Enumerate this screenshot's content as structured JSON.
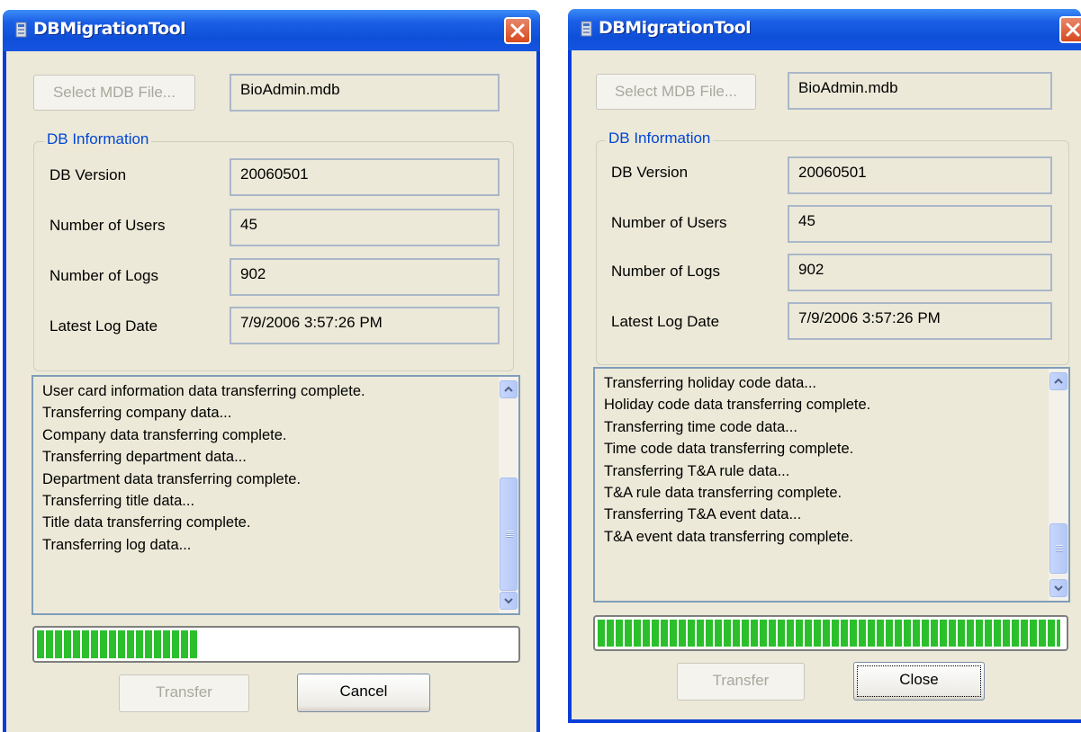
{
  "windows": [
    {
      "id": "left",
      "title": "DBMigrationTool",
      "select_button": "Select MDB File...",
      "file_name": "BioAdmin.mdb",
      "group_title": "DB Information",
      "fields": [
        {
          "label": "DB Version",
          "value": "20060501"
        },
        {
          "label": "Number of Users",
          "value": "45"
        },
        {
          "label": "Number of Logs",
          "value": "902"
        },
        {
          "label": "Latest Log Date",
          "value": "7/9/2006 3:57:26 PM"
        }
      ],
      "log_lines": [
        "User card information data transferring complete.",
        "Transferring company data...",
        "Company data transferring complete.",
        "Transferring department data...",
        "Department data transferring complete.",
        "Transferring title data...",
        "Title data transferring complete.",
        "Transferring log data..."
      ],
      "progress_fraction": 0.34,
      "transfer_button": "Transfer",
      "second_button": "Cancel"
    },
    {
      "id": "right",
      "title": "DBMigrationTool",
      "select_button": "Select MDB File...",
      "file_name": "BioAdmin.mdb",
      "group_title": "DB Information",
      "fields": [
        {
          "label": "DB Version",
          "value": "20060501"
        },
        {
          "label": "Number of Users",
          "value": "45"
        },
        {
          "label": "Number of Logs",
          "value": "902"
        },
        {
          "label": "Latest Log Date",
          "value": "7/9/2006 3:57:26 PM"
        }
      ],
      "log_lines": [
        "Transferring holiday code data...",
        "Holiday code data transferring complete.",
        "Transferring time code data...",
        "Time code data transferring complete.",
        "Transferring T&A rule data...",
        "T&A rule data transferring complete.",
        "Transferring T&A event data...",
        "T&A event data transferring complete."
      ],
      "progress_fraction": 1.0,
      "transfer_button": "Transfer",
      "second_button": "Close"
    }
  ],
  "icons": {
    "title_icon": "app-db-icon",
    "close_icon": "close-icon",
    "scroll_up": "arrow-up-icon",
    "scroll_down": "arrow-down-icon"
  },
  "colors": {
    "title_bar": "#0f4fd8",
    "dialog_bg": "#ece9d8",
    "group_label": "#0046d5",
    "progress": "#2bc02b",
    "close_button": "#d7491f"
  }
}
